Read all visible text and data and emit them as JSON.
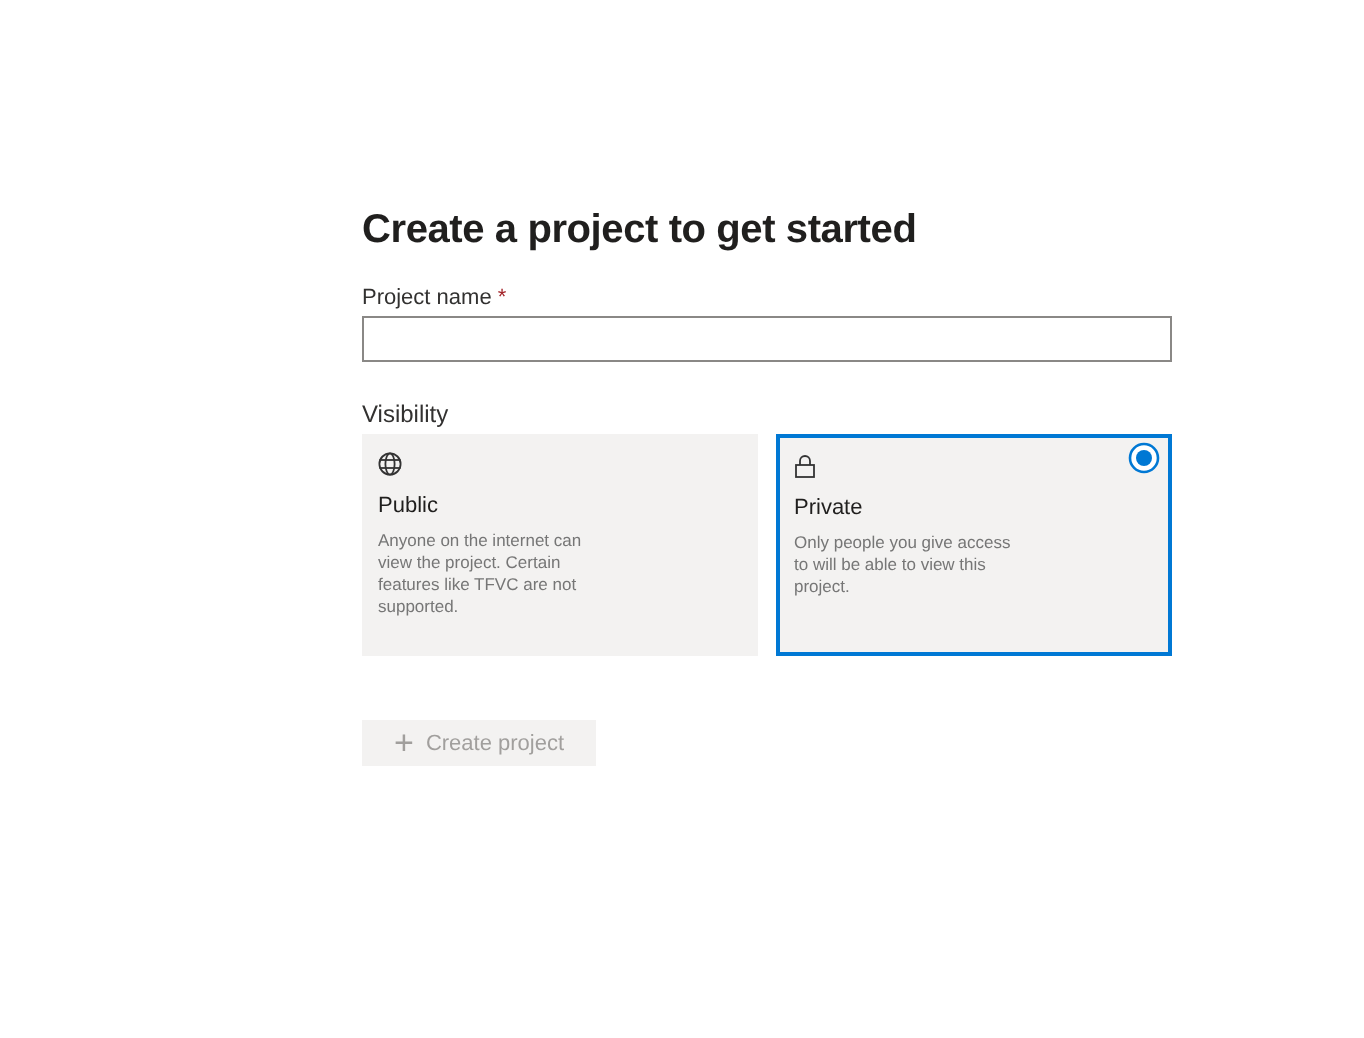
{
  "heading": "Create a project to get started",
  "project_name": {
    "label": "Project name",
    "required_mark": "*"
  },
  "visibility": {
    "label": "Visibility",
    "options": [
      {
        "title": "Public",
        "description": "Anyone on the internet can view the project. Certain features like TFVC are not supported.",
        "selected": false
      },
      {
        "title": "Private",
        "description": "Only people you give access to will be able to view this project.",
        "selected": true
      }
    ]
  },
  "create_button": {
    "icon": "+",
    "label": "Create project",
    "disabled": true
  }
}
